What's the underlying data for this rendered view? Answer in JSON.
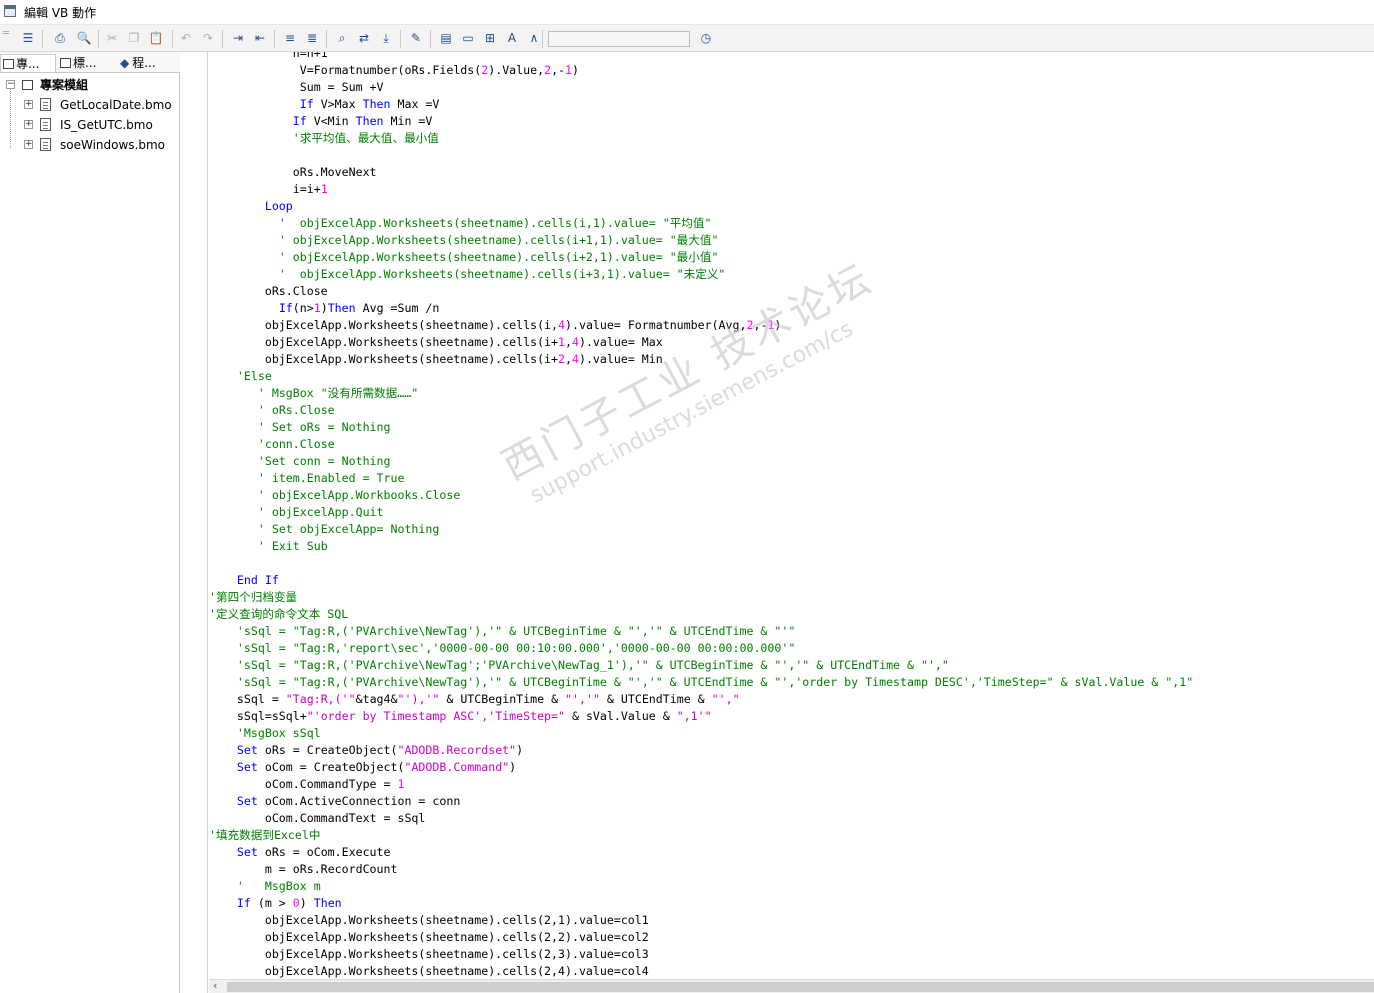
{
  "window": {
    "title": "編輯 VB 動作"
  },
  "toolbar": {
    "buttons": [
      {
        "name": "align-left-icon",
        "glyph": "☰"
      },
      {
        "name": "print-icon",
        "glyph": "⎙"
      },
      {
        "name": "print-preview-icon",
        "glyph": "🔍"
      },
      {
        "name": "cut-icon",
        "glyph": "✂"
      },
      {
        "name": "copy-icon",
        "glyph": "❐"
      },
      {
        "name": "paste-icon",
        "glyph": "📋"
      },
      {
        "name": "undo-icon",
        "glyph": "↶"
      },
      {
        "name": "redo-icon",
        "glyph": "↷"
      },
      {
        "name": "indent-icon",
        "glyph": "⇥"
      },
      {
        "name": "outdent-icon",
        "glyph": "⇤"
      },
      {
        "name": "comment-icon",
        "glyph": "≡"
      },
      {
        "name": "uncomment-icon",
        "glyph": "≣"
      },
      {
        "name": "find-icon",
        "glyph": "⌕"
      },
      {
        "name": "replace-icon",
        "glyph": "⇄"
      },
      {
        "name": "goto-icon",
        "glyph": "⤓"
      },
      {
        "name": "breakpoint-icon",
        "glyph": "✎"
      },
      {
        "name": "save-icon",
        "glyph": "▤"
      },
      {
        "name": "open-folder-icon",
        "glyph": "▭"
      },
      {
        "name": "new-folder-icon",
        "glyph": "⊞"
      },
      {
        "name": "font-icon",
        "glyph": "A"
      },
      {
        "name": "compile-icon",
        "glyph": "∧"
      },
      {
        "name": "clock-icon",
        "glyph": "◷"
      }
    ],
    "combo_value": ""
  },
  "left_pane": {
    "tabs": [
      "專...",
      "標...",
      "程..."
    ],
    "tree": {
      "root": "專案模組",
      "items": [
        "GetLocalDate.bmo",
        "IS_GetUTC.bmo",
        "soeWindows.bmo"
      ]
    }
  },
  "editor": {
    "lines": [
      [
        [
          "n=n+1",
          ""
        ]
      ],
      [
        [
          "V=",
          "pl"
        ],
        [
          "Formatnumber",
          "pl"
        ],
        [
          "(oRs.Fields(",
          "pl"
        ],
        [
          "2",
          "nu"
        ],
        [
          ").Value,",
          "pl"
        ],
        [
          "2",
          "nu"
        ],
        [
          ",-",
          "pl"
        ],
        [
          "1",
          "nu"
        ],
        [
          ")",
          "pl"
        ]
      ],
      [
        [
          "Sum = Sum +V",
          "pl"
        ]
      ],
      [
        [
          "If",
          "kw"
        ],
        [
          " V>Max ",
          "pl"
        ],
        [
          "Then",
          "kw"
        ],
        [
          " Max =V",
          "pl"
        ]
      ],
      [
        [
          "If",
          "kw"
        ],
        [
          " V<Min ",
          "pl"
        ],
        [
          "Then",
          "kw"
        ],
        [
          " Min =V",
          "pl"
        ]
      ],
      [
        [
          "'求平均值、最大值、最小值",
          "cm"
        ]
      ],
      [],
      [
        [
          "oRs.MoveNext",
          "pl"
        ]
      ],
      [
        [
          "i=i+",
          "pl"
        ],
        [
          "1",
          "nu"
        ]
      ],
      [
        [
          "Loop",
          "kw"
        ]
      ],
      [
        [
          "'  objExcelApp.Worksheets(sheetname).cells(i,1).value= \"平均值\"",
          "cm"
        ]
      ],
      [
        [
          "' objExcelApp.Worksheets(sheetname).cells(i+1,1).value= \"最大值\"",
          "cm"
        ]
      ],
      [
        [
          "' objExcelApp.Worksheets(sheetname).cells(i+2,1).value= \"最小值\"",
          "cm"
        ]
      ],
      [
        [
          "'  objExcelApp.Worksheets(sheetname).cells(i+3,1).value= \"未定义\"",
          "cm"
        ]
      ],
      [
        [
          "oRs.Close",
          "pl"
        ]
      ],
      [
        [
          "If",
          "kw"
        ],
        [
          "(n>",
          "pl"
        ],
        [
          "1",
          "nu"
        ],
        [
          ")",
          "pl"
        ],
        [
          "Then",
          "kw"
        ],
        [
          " Avg =Sum /n",
          "pl"
        ]
      ],
      [
        [
          "objExcelApp.Worksheets(sheetname).cells(i,",
          "pl"
        ],
        [
          "4",
          "nu"
        ],
        [
          ").value= Formatnumber(Avg,",
          "pl"
        ],
        [
          "2",
          "nu"
        ],
        [
          ",-",
          "pl"
        ],
        [
          "1",
          "nu"
        ],
        [
          ")",
          "pl"
        ]
      ],
      [
        [
          "objExcelApp.Worksheets(sheetname).cells(i+",
          "pl"
        ],
        [
          "1",
          "nu"
        ],
        [
          ",",
          "pl"
        ],
        [
          "4",
          "nu"
        ],
        [
          ").value= Max",
          "pl"
        ]
      ],
      [
        [
          "objExcelApp.Worksheets(sheetname).cells(i+",
          "pl"
        ],
        [
          "2",
          "nu"
        ],
        [
          ",",
          "pl"
        ],
        [
          "4",
          "nu"
        ],
        [
          ").value= Min",
          "pl"
        ]
      ],
      [
        [
          "'Else",
          "cm"
        ]
      ],
      [
        [
          "' MsgBox \"没有所需数据……\"",
          "cm"
        ]
      ],
      [
        [
          "' oRs.Close",
          "cm"
        ]
      ],
      [
        [
          "' Set oRs = Nothing",
          "cm"
        ]
      ],
      [
        [
          "'conn.Close",
          "cm"
        ]
      ],
      [
        [
          "'Set conn = Nothing",
          "cm"
        ]
      ],
      [
        [
          "' item.Enabled = True",
          "cm"
        ]
      ],
      [
        [
          "' objExcelApp.Workbooks.Close",
          "cm"
        ]
      ],
      [
        [
          "' objExcelApp.Quit",
          "cm"
        ]
      ],
      [
        [
          "' Set objExcelApp= Nothing",
          "cm"
        ]
      ],
      [
        [
          "' Exit Sub",
          "cm"
        ]
      ],
      [],
      [
        [
          "End If",
          "kw"
        ]
      ],
      [
        [
          "'第四个归档变量",
          "cm"
        ]
      ],
      [
        [
          "'定义查询的命令文本 SQL",
          "cm"
        ]
      ],
      [
        [
          "'sSql = \"Tag:R,('PVArchive\\NewTag'),'\" & UTCBeginTime & \"','\" & UTCEndTime & \"'\"",
          "cm"
        ]
      ],
      [
        [
          "'sSql = \"Tag:R,'report\\sec','0000-00-00 00:10:00.000','0000-00-00 00:00:00.000'\"",
          "cm"
        ]
      ],
      [
        [
          "'sSql = \"Tag:R,('PVArchive\\NewTag';'PVArchive\\NewTag_1'),'\" & UTCBeginTime & \"','\" & UTCEndTime & \"',\"",
          "cm"
        ]
      ],
      [
        [
          "'sSql = \"Tag:R,('PVArchive\\NewTag'),'\" & UTCBeginTime & \"','\" & UTCEndTime & \"','order by Timestamp DESC','TimeStep=\" & sVal.Value & \",1\"",
          "cm"
        ]
      ],
      [
        [
          "sSql = ",
          "pl"
        ],
        [
          "\"Tag:R,('\"",
          "st"
        ],
        [
          "&tag4&",
          "pl"
        ],
        [
          "\"'),'\"",
          "st"
        ],
        [
          " & UTCBeginTime & ",
          "pl"
        ],
        [
          "\"','\"",
          "st"
        ],
        [
          " & UTCEndTime & ",
          "pl"
        ],
        [
          "\"',\"",
          "st"
        ]
      ],
      [
        [
          "sSql=sSql+",
          "pl"
        ],
        [
          "\"'order by Timestamp ASC','TimeStep=\"",
          "st"
        ],
        [
          " & sVal.Value & ",
          "pl"
        ],
        [
          "\",1'\"",
          "st"
        ]
      ],
      [
        [
          "'MsgBox sSql",
          "cm"
        ]
      ],
      [
        [
          "Set",
          "kw"
        ],
        [
          " oRs = CreateObject(",
          "pl"
        ],
        [
          "\"ADODB.Recordset\"",
          "st"
        ],
        [
          ")",
          "pl"
        ]
      ],
      [
        [
          "Set",
          "kw"
        ],
        [
          " oCom = CreateObject(",
          "pl"
        ],
        [
          "\"ADODB.Command\"",
          "st"
        ],
        [
          ")",
          "pl"
        ]
      ],
      [
        [
          "oCom.CommandType = ",
          "pl"
        ],
        [
          "1",
          "nu"
        ]
      ],
      [
        [
          "Set",
          "kw"
        ],
        [
          " oCom.ActiveConnection = conn",
          "pl"
        ]
      ],
      [
        [
          "oCom.CommandText = sSql",
          "pl"
        ]
      ],
      [
        [
          "'填充数据到Excel中",
          "cm"
        ]
      ],
      [
        [
          "Set",
          "kw"
        ],
        [
          " oRs = oCom.Execute",
          "pl"
        ]
      ],
      [
        [
          "m = oRs.RecordCount",
          "pl"
        ]
      ],
      [
        [
          "'   MsgBox m",
          "cm"
        ]
      ],
      [
        [
          "If",
          "kw"
        ],
        [
          " (m > ",
          "pl"
        ],
        [
          "0",
          "nu"
        ],
        [
          ") ",
          "pl"
        ],
        [
          "Then",
          "kw"
        ]
      ],
      [
        [
          "objExcelApp.Worksheets(sheetname).cells(2,1).value=col1",
          "pl"
        ]
      ],
      [
        [
          "objExcelApp.Worksheets(sheetname).cells(2,2).value=col2",
          "pl"
        ]
      ],
      [
        [
          "objExcelApp.Worksheets(sheetname).cells(2,3).value=col3",
          "pl"
        ]
      ],
      [
        [
          "objExcelApp.Worksheets(sheetname).cells(2,4).value=col4",
          "pl"
        ]
      ]
    ],
    "indent": [
      12,
      13,
      13,
      13,
      12,
      12,
      0,
      12,
      12,
      8,
      10,
      10,
      10,
      10,
      8,
      10,
      8,
      8,
      8,
      4,
      7,
      7,
      7,
      7,
      7,
      7,
      7,
      7,
      7,
      7,
      0,
      4,
      0,
      0,
      4,
      4,
      4,
      4,
      4,
      4,
      4,
      4,
      4,
      8,
      4,
      8,
      0,
      4,
      8,
      4,
      4,
      8,
      8,
      8,
      8
    ]
  },
  "watermark": {
    "line1": "西门子工业 技术论坛",
    "line2": "support.industry.siemens.com/cs"
  },
  "colors": {
    "comment": "#008000",
    "keyword": "#0000ff",
    "string": "#cc00cc",
    "number": "#ff00ff"
  }
}
